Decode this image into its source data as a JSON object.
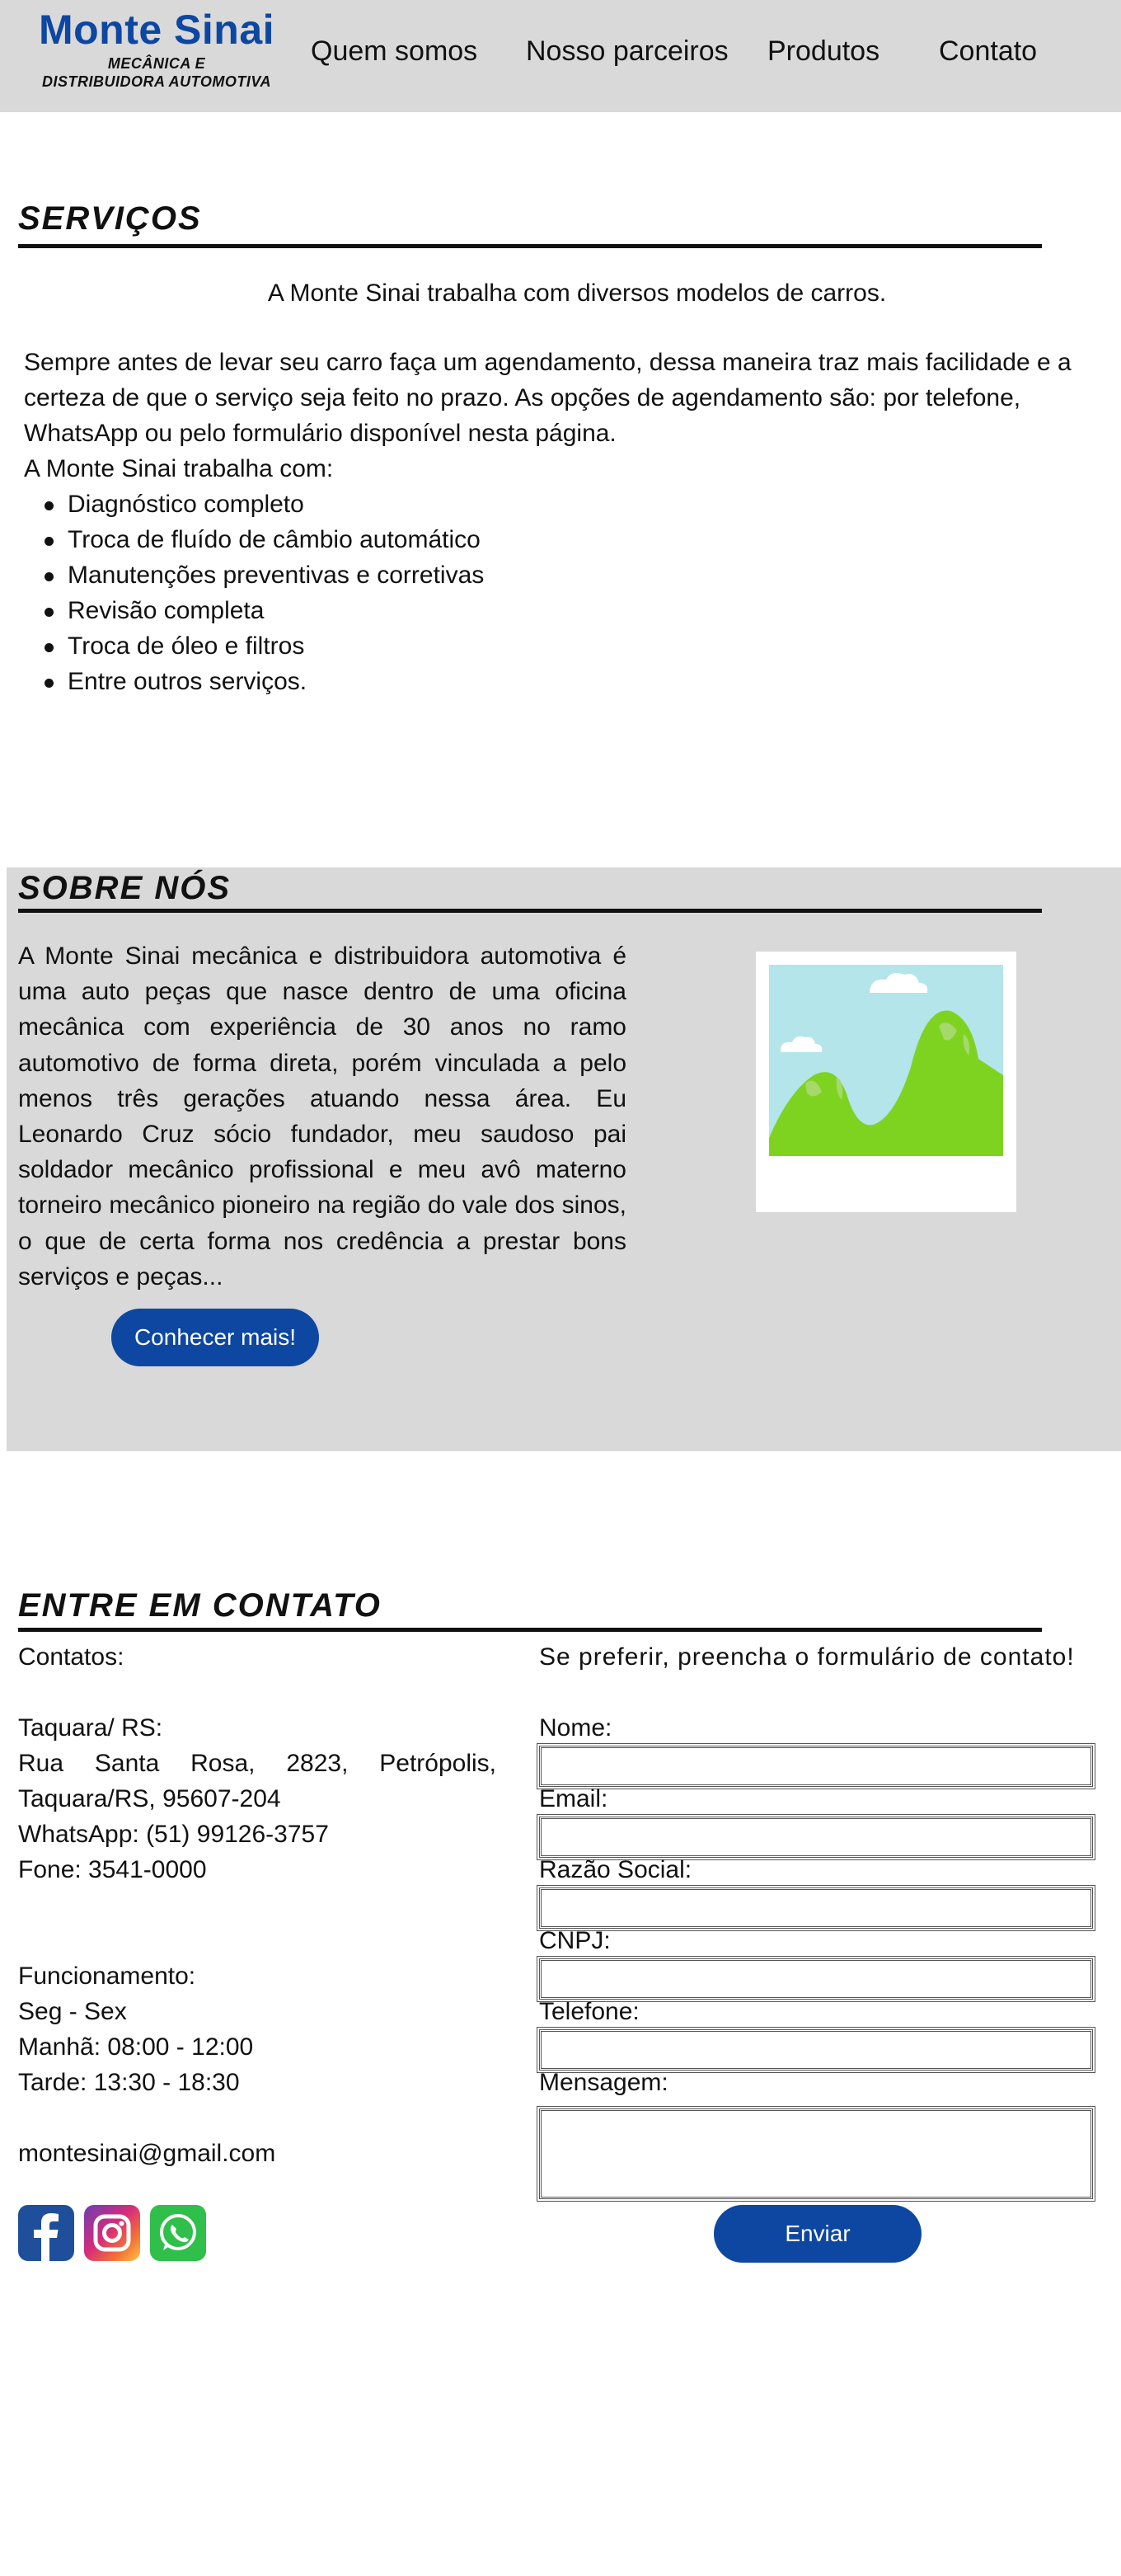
{
  "header": {
    "brand_name": "Monte Sinai",
    "brand_sub_line1": "MECÂNICA E",
    "brand_sub_line2": "DISTRIBUIDORA AUTOMOTIVA",
    "nav": [
      "Quem somos",
      "Nosso parceiros",
      "Produtos",
      "Contato"
    ]
  },
  "services": {
    "title": "SERVIÇOS",
    "intro": "A Monte Sinai trabalha com diversos modelos de carros.",
    "p_line1": "Sempre antes de levar seu carro faça um agendamento, dessa maneira traz mais facilidade e a",
    "p_line2": "certeza de que o serviço seja feito no prazo. As opções de agendamento são: por telefone,",
    "p_line3": "WhatsApp ou pelo formulário disponível nesta página.",
    "list_intro": "A Monte Sinai trabalha com:",
    "items": [
      "Diagnóstico completo",
      "Troca de fluído de câmbio automático",
      "Manutenções preventivas e corretivas",
      "Revisão completa",
      "Troca de óleo e filtros",
      "Entre outros serviços."
    ]
  },
  "about": {
    "title": "SOBRE NÓS",
    "text": "A Monte Sinai mecânica e  distribuidora automotiva é uma auto peças que nasce dentro de uma oficina mecânica com experiência de 30 anos no ramo automotivo de forma direta, porém vinculada a pelo menos três gerações atuando nessa área. Eu Leonardo Cruz sócio fundador, meu saudoso pai soldador mecânico profissional e meu avô materno torneiro mecânico pioneiro na região do vale dos sinos, o que de certa forma nos credência a prestar bons serviços e peças...",
    "button": "Conhecer mais!",
    "image_icon": "landscape-image-placeholder"
  },
  "contact": {
    "title": "ENTRE EM CONTATO",
    "contacts_label": "Contatos:",
    "city": "Taquara/ RS:",
    "address_line1": "Rua Santa Rosa, 2823, Petrópolis,",
    "address_line2": "Taquara/RS, 95607-204",
    "whatsapp": "WhatsApp: (51) 99126-3757",
    "phone": "Fone: 3541-0000",
    "hours_label": "Funcionamento:",
    "days": "Seg - Sex",
    "morning": "Manhã: 08:00 - 12:00",
    "afternoon": "Tarde: 13:30 - 18:30",
    "email": "montesinai@gmail.com",
    "social_icons": [
      "facebook-icon",
      "instagram-icon",
      "whatsapp-icon"
    ],
    "form_title": "Se preferir, preencha o formulário de contato!",
    "form_labels": {
      "name": "Nome:",
      "email": "Email:",
      "company": "Razão Social:",
      "cnpj": "CNPJ:",
      "phone": "Telefone:",
      "message": "Mensagem:"
    },
    "submit": "Enviar"
  },
  "colors": {
    "brand_blue": "#0d47a1",
    "header_bg": "#d9d9d9",
    "section_bg": "#d9d9d9"
  }
}
